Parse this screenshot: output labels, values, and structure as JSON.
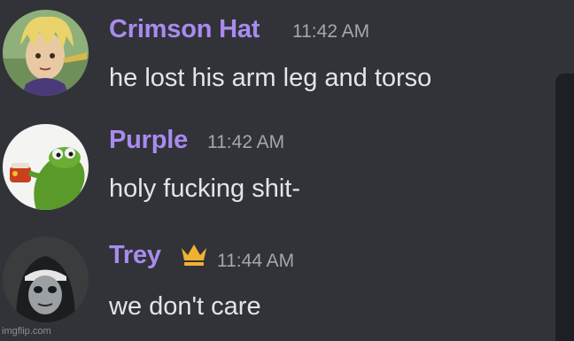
{
  "messages": [
    {
      "author": "Crimson Hat",
      "time": "11:42 AM",
      "text": "he lost his arm leg and torso",
      "avatar_icon": "blond-anime-character-avatar-icon"
    },
    {
      "author": "Purple",
      "time": "11:42 AM",
      "text": "holy fucking shit-",
      "avatar_icon": "kermit-sipping-tea-avatar-icon"
    },
    {
      "author": "Trey",
      "time": "11:44 AM",
      "text": "we don't care",
      "avatar_icon": "masked-figure-avatar-icon",
      "badge_icon": "crown-icon"
    }
  ],
  "watermark": "imgflip.com",
  "colors": {
    "background": "#313338",
    "author_name": "#a98bef",
    "message_text": "#e3e5e8",
    "timestamp": "#a3a6ad",
    "crown": "#f0b232"
  }
}
